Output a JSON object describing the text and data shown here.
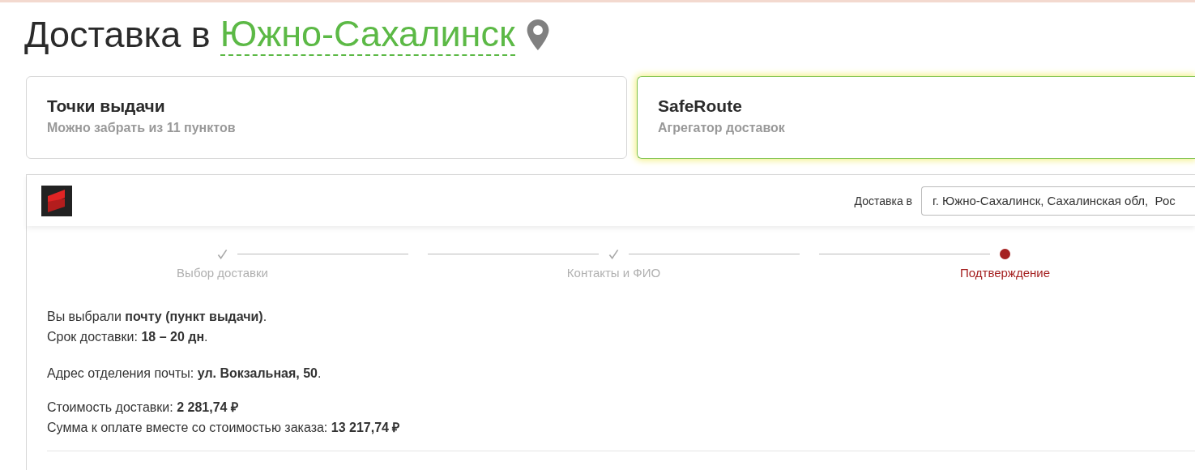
{
  "heading": {
    "prefix": "Доставка в",
    "city": "Южно-Сахалинск"
  },
  "delivery_options": [
    {
      "title": "Точки выдачи",
      "subtitle": "Можно забрать из 11 пунктов",
      "selected": false
    },
    {
      "title": "SafeRoute",
      "subtitle": "Агрегатор доставок",
      "selected": true
    }
  ],
  "widget": {
    "address_label": "Доставка в",
    "address_value": "г. Южно-Сахалинск, Сахалинская обл,  Рос",
    "steps": [
      {
        "label": "Выбор доставки",
        "kind": "done"
      },
      {
        "label": "Контакты и ФИО",
        "kind": "done"
      },
      {
        "label": "Подтверждение",
        "kind": "current"
      }
    ],
    "summary": [
      [
        "Вы выбрали **почту (пункт выдачи)**.",
        "Срок доставки: **18 – 20 дн**."
      ],
      [
        "Адрес отделения почты: **ул. Вокзальная, 50**."
      ],
      [
        "Стоимость доставки: **2 281,74 ₽**",
        "Сумма к оплате вместе со стоимостью заказа: **13 217,74 ₽**"
      ]
    ]
  }
}
